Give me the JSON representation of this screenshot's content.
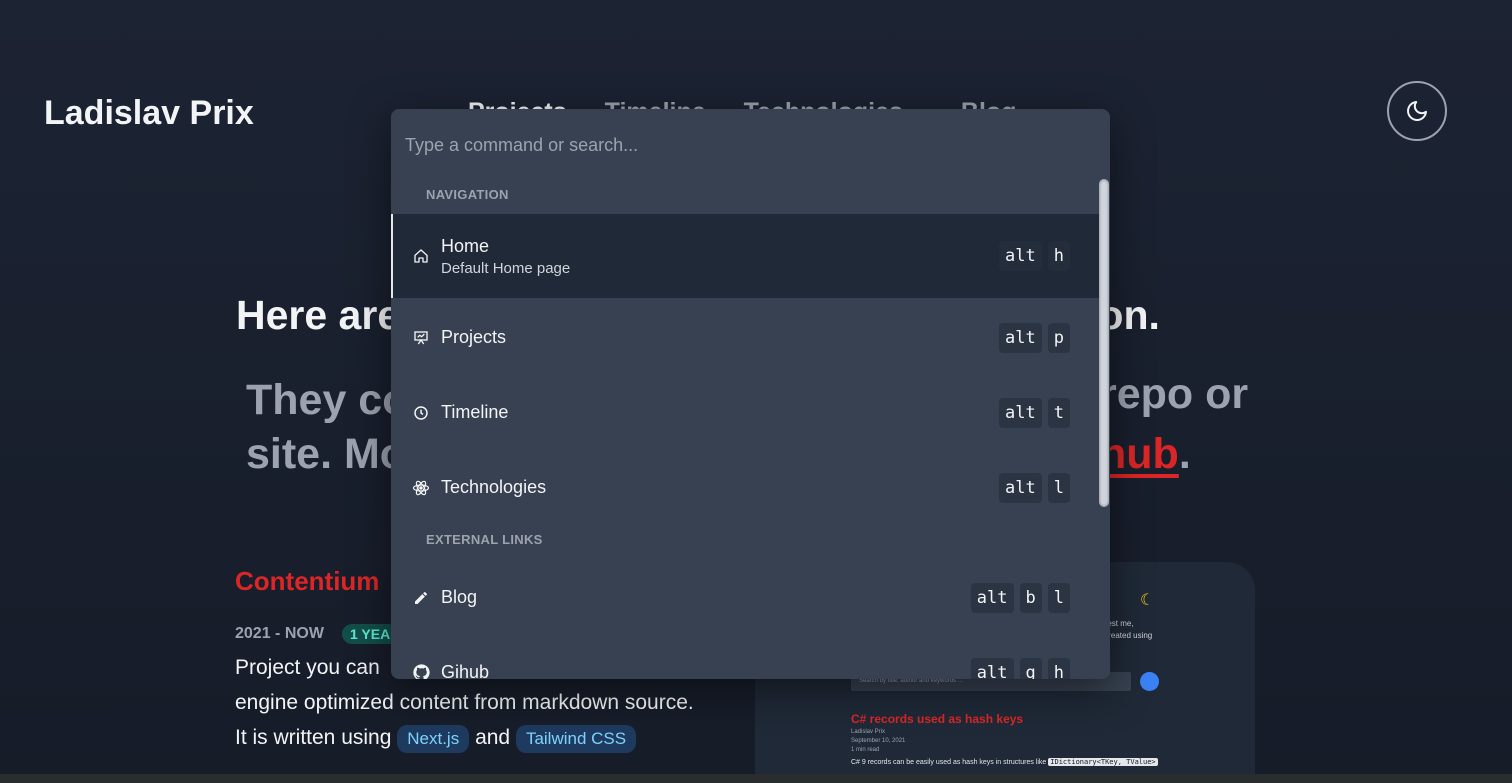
{
  "site": {
    "title": "Ladislav Prix"
  },
  "nav": [
    "Projects",
    "Timeline",
    "Technologies",
    "Blog"
  ],
  "theme_toggle": {
    "icon": "moon-icon"
  },
  "content": {
    "heading_start": "Here are",
    "heading_end": "d on.",
    "sub_line1_start": "They co",
    "sub_line1_end": "repo or",
    "sub_line2_start": "site. Mo",
    "sub_line2_link": "hub",
    "sub_line2_end": ".",
    "project": {
      "title": "Contentium",
      "date": "2021 - NOW",
      "badge": "1 YEA",
      "desc_line1": "Project you can",
      "desc_line2": "engine optimized content from markdown source.",
      "desc_line3_prefix": "It is written using",
      "tech1": "Next.js",
      "conj": "and",
      "tech2": "Tailwind CSS"
    },
    "preview": {
      "text1": "terest me,",
      "text2": "s created using",
      "search_placeholder": "Search by title, author and keywords ...",
      "post_title": "C# records used as hash keys",
      "author": "Ladislav Prix",
      "date": "September 10, 2021",
      "read": "1 min read",
      "body_prefix": "C# 9 records can be easily used as hash keys in structures like",
      "body_code": "IDictionary<TKey, TValue>"
    }
  },
  "palette": {
    "placeholder": "Type a command or search...",
    "sections": [
      {
        "label": "NAVIGATION"
      },
      {
        "label": "EXTERNAL LINKS"
      }
    ],
    "items": [
      {
        "label": "Home",
        "desc": "Default Home page",
        "icon": "home-icon",
        "keys": [
          "alt",
          "h"
        ],
        "selected": true
      },
      {
        "label": "Projects",
        "icon": "presentation-icon",
        "keys": [
          "alt",
          "p"
        ]
      },
      {
        "label": "Timeline",
        "icon": "clock-icon",
        "keys": [
          "alt",
          "t"
        ]
      },
      {
        "label": "Technologies",
        "icon": "atom-icon",
        "keys": [
          "alt",
          "l"
        ]
      },
      {
        "label": "Blog",
        "icon": "pencil-icon",
        "keys": [
          "alt",
          "b",
          "l"
        ]
      },
      {
        "label": "Gihub",
        "icon": "github-icon",
        "keys": [
          "alt",
          "g",
          "h"
        ]
      }
    ]
  }
}
